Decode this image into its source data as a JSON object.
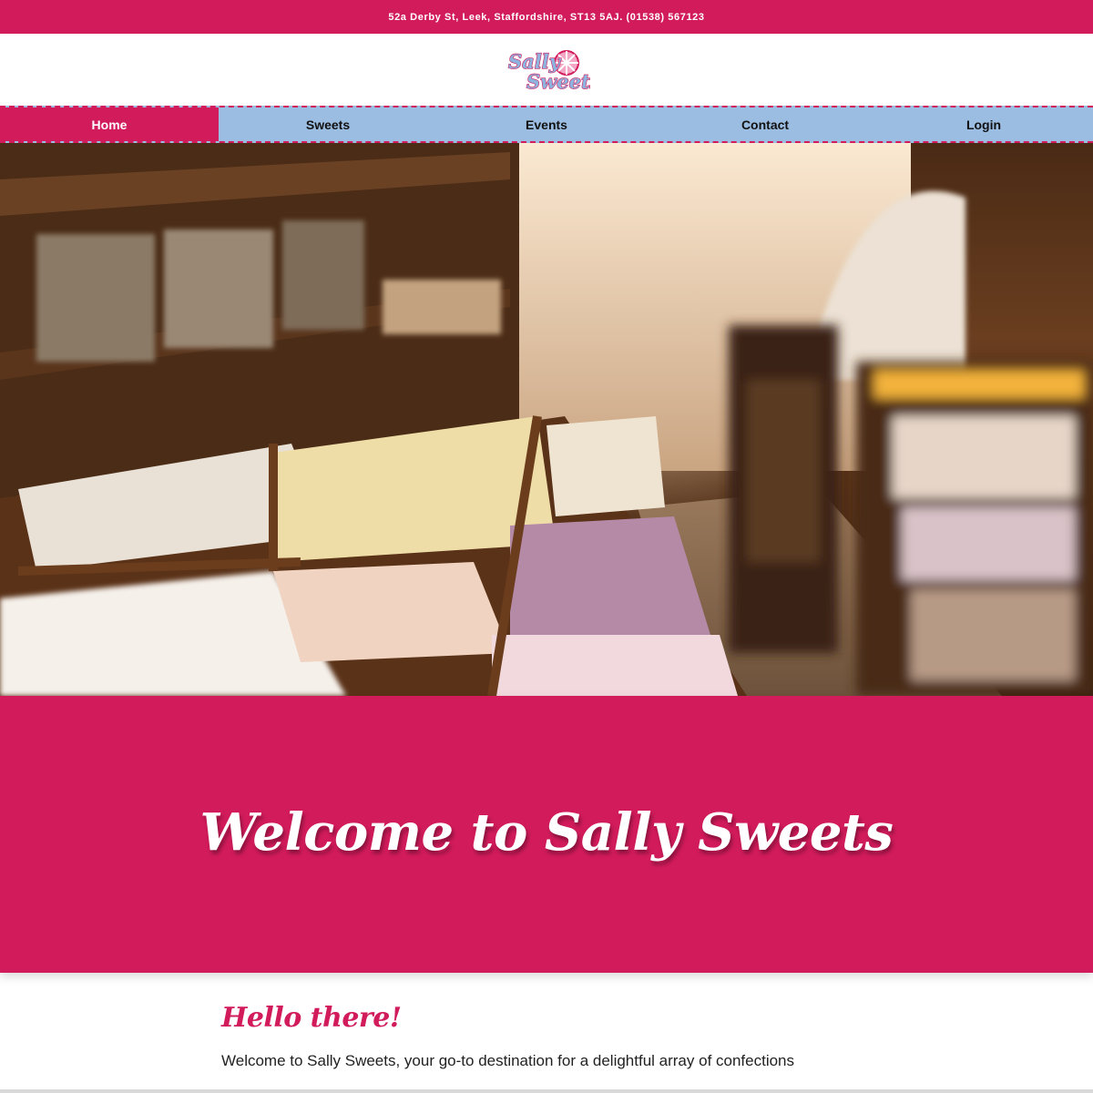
{
  "topbar": {
    "address": "52a Derby St, Leek, Staffordshire, ST13 5AJ. (01538) 567123"
  },
  "logo": {
    "line1": "Sally",
    "line2": "Sweets",
    "colors": {
      "text": "#8fb3df",
      "outline": "#d21b5b",
      "candy": "#f3a6c6"
    }
  },
  "nav": {
    "items": [
      {
        "label": "Home",
        "active": true
      },
      {
        "label": "Sweets",
        "active": false
      },
      {
        "label": "Events",
        "active": false
      },
      {
        "label": "Contact",
        "active": false
      },
      {
        "label": "Login",
        "active": false
      }
    ]
  },
  "hero": {
    "image": "sweet-shop-interior"
  },
  "welcome": {
    "title": "Welcome to Sally Sweets"
  },
  "content": {
    "heading": "Hello there!",
    "intro": "Welcome to Sally Sweets, your go-to destination for a delightful array of confections"
  },
  "colors": {
    "brand_pink": "#d21b5b",
    "nav_blue": "#9bbde2",
    "white": "#ffffff"
  }
}
